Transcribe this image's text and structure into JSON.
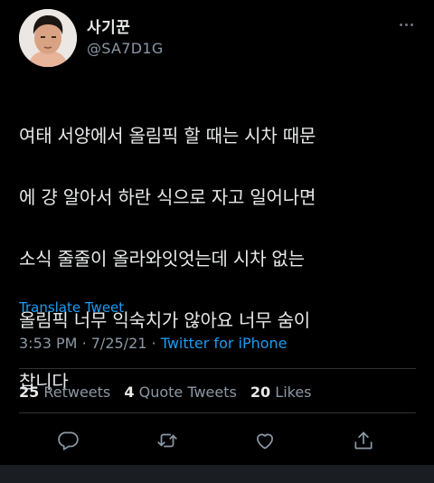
{
  "user": {
    "display_name": "사기꾼",
    "handle": "@SA7D1G"
  },
  "tweet": {
    "text_lines": [
      "여태 서양에서 올림픽 할 때는 시차 때문",
      "에 걍 알아서 하란 식으로 자고 일어나면",
      "소식 줄줄이 올라와잇엇는데 시차 없는",
      "올림픽 너무 익숙치가 않아요 너무 숨이",
      "찹니다"
    ],
    "translate_label": "Translate Tweet",
    "time": "3:53 PM",
    "date": "7/25/21",
    "separator": "·",
    "source": "Twitter for iPhone"
  },
  "stats": {
    "retweets": {
      "count": "25",
      "label": "Retweets"
    },
    "quote_tweets": {
      "count": "4",
      "label": "Quote Tweets"
    },
    "likes": {
      "count": "20",
      "label": "Likes"
    }
  },
  "actions": [
    {
      "name": "reply-icon"
    },
    {
      "name": "retweet-icon"
    },
    {
      "name": "like-icon"
    },
    {
      "name": "share-icon"
    }
  ],
  "colors": {
    "background": "#000000",
    "text_primary": "#e7e9ea",
    "text_secondary": "#8b98a5",
    "link": "#1d9bf0",
    "divider": "#2f3336"
  }
}
